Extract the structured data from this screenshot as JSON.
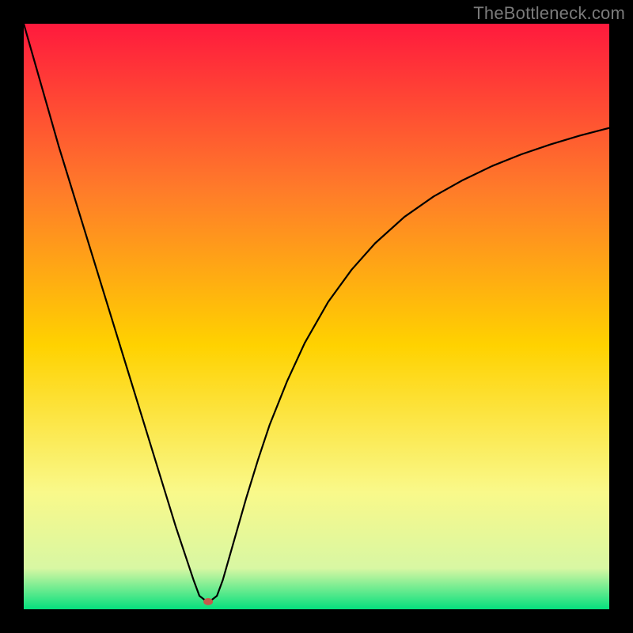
{
  "watermark": "TheBottleneck.com",
  "chart_data": {
    "type": "line",
    "title": "",
    "xlabel": "",
    "ylabel": "",
    "xlim": [
      0,
      100
    ],
    "ylim": [
      0,
      100
    ],
    "grid": false,
    "background_gradient": {
      "top": "#ff1a3d",
      "mid_upper": "#ff7a2a",
      "mid": "#ffd200",
      "mid_lower": "#f9f98a",
      "band": "#d8f7a3",
      "bottom": "#05e07d"
    },
    "series": [
      {
        "name": "curve",
        "color": "#000000",
        "x": [
          0,
          2,
          4,
          6,
          8,
          10,
          12,
          14,
          16,
          18,
          20,
          22,
          24,
          26,
          28,
          29,
          30,
          31,
          32,
          33,
          34,
          36,
          38,
          40,
          42,
          45,
          48,
          52,
          56,
          60,
          65,
          70,
          75,
          80,
          85,
          90,
          95,
          100
        ],
        "y": [
          100,
          93,
          86,
          79,
          72.5,
          66,
          59.5,
          53,
          46.5,
          40,
          33.5,
          27,
          20.5,
          14,
          8,
          5,
          2.3,
          1.5,
          1.5,
          2.3,
          5,
          12,
          19,
          25.5,
          31.5,
          39,
          45.5,
          52.5,
          58,
          62.5,
          67,
          70.5,
          73.3,
          75.7,
          77.7,
          79.4,
          80.9,
          82.2
        ]
      }
    ],
    "marker": {
      "name": "minimum-point",
      "x": 31.5,
      "y": 1.3,
      "color": "#c65a4a",
      "rx": 6,
      "ry": 4.5
    }
  }
}
